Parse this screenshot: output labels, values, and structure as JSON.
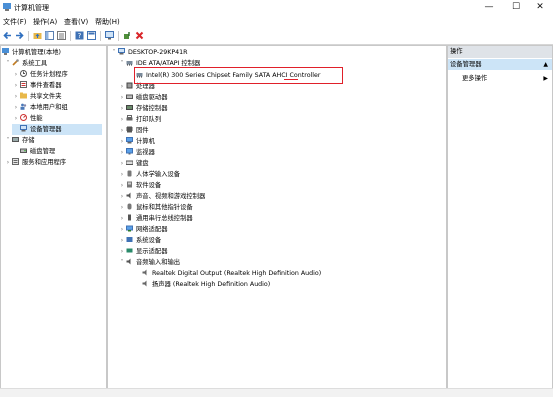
{
  "window": {
    "title": "计算机管理",
    "min": "—",
    "max": "☐",
    "close": "✕"
  },
  "menu": [
    "文件(F)",
    "操作(A)",
    "查看(V)",
    "帮助(H)"
  ],
  "left_tree": [
    {
      "label": "计算机管理(本地)"
    },
    {
      "label": "系统工具"
    },
    {
      "label": "任务计划程序"
    },
    {
      "label": "事件查看器"
    },
    {
      "label": "共享文件夹"
    },
    {
      "label": "本地用户和组"
    },
    {
      "label": "性能"
    },
    {
      "label": "设备管理器"
    },
    {
      "label": "存储"
    },
    {
      "label": "磁盘管理"
    },
    {
      "label": "服务和应用程序"
    }
  ],
  "device_tree": [
    {
      "label": "DESKTOP-29KP41R"
    },
    {
      "label": "IDE ATA/ATAPI 控制器"
    },
    {
      "label": "Intel(R) 300 Series Chipset Family SATA AHCI Controller"
    },
    {
      "label": "处理器"
    },
    {
      "label": "磁盘驱动器"
    },
    {
      "label": "存储控制器"
    },
    {
      "label": "打印队列"
    },
    {
      "label": "固件"
    },
    {
      "label": "计算机"
    },
    {
      "label": "监视器"
    },
    {
      "label": "键盘"
    },
    {
      "label": "人体学输入设备"
    },
    {
      "label": "软件设备"
    },
    {
      "label": "声音、视频和游戏控制器"
    },
    {
      "label": "鼠标和其他指针设备"
    },
    {
      "label": "通用串行总线控制器"
    },
    {
      "label": "网络适配器"
    },
    {
      "label": "系统设备"
    },
    {
      "label": "显示适配器"
    },
    {
      "label": "音频输入和输出"
    },
    {
      "label": "Realtek Digital Output (Realtek High Definition Audio)"
    },
    {
      "label": "扬声器 (Realtek High Definition Audio)"
    }
  ],
  "actions": {
    "header": "操作",
    "selected": "设备管理器",
    "more": "更多操作"
  }
}
